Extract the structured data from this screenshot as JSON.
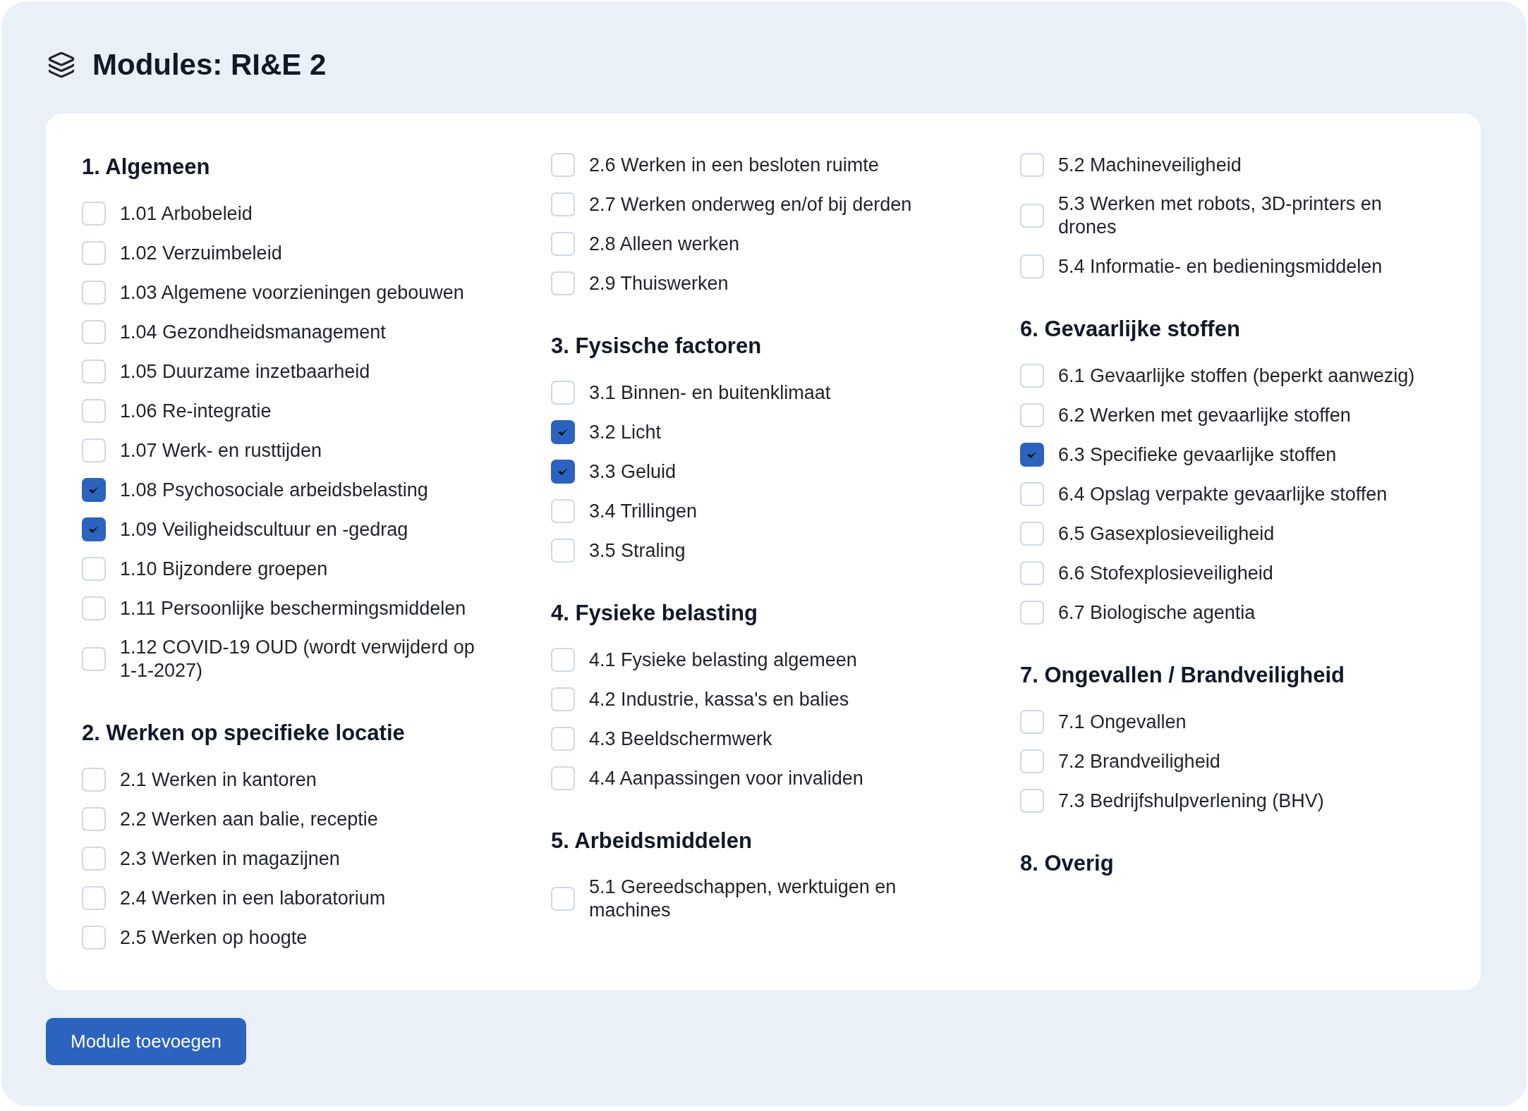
{
  "title": "Modules: RI&E 2",
  "columns": [
    {
      "sections": [
        {
          "heading": "1. Algemeen",
          "modules": [
            {
              "label": "1.01 Arbobeleid",
              "checked": false
            },
            {
              "label": "1.02 Verzuimbeleid",
              "checked": false
            },
            {
              "label": "1.03 Algemene voorzieningen gebouwen",
              "checked": false
            },
            {
              "label": "1.04 Gezondheidsmanagement",
              "checked": false
            },
            {
              "label": "1.05 Duurzame inzetbaarheid",
              "checked": false
            },
            {
              "label": "1.06 Re-integratie",
              "checked": false
            },
            {
              "label": "1.07 Werk- en rusttijden",
              "checked": false
            },
            {
              "label": "1.08 Psychosociale arbeidsbelasting",
              "checked": true
            },
            {
              "label": "1.09 Veiligheidscultuur en -gedrag",
              "checked": true
            },
            {
              "label": "1.10 Bijzondere groepen",
              "checked": false
            },
            {
              "label": "1.11 Persoonlijke beschermingsmiddelen",
              "checked": false
            },
            {
              "label": "1.12 COVID-19 OUD (wordt verwijderd op 1-1-2027)",
              "checked": false
            }
          ]
        },
        {
          "heading": "2. Werken op specifieke locatie",
          "modules": [
            {
              "label": "2.1 Werken in kantoren",
              "checked": false
            },
            {
              "label": "2.2 Werken aan balie, receptie",
              "checked": false
            },
            {
              "label": "2.3 Werken in magazijnen",
              "checked": false
            },
            {
              "label": "2.4 Werken in een laboratorium",
              "checked": false
            },
            {
              "label": "2.5 Werken op hoogte",
              "checked": false
            }
          ]
        }
      ]
    },
    {
      "sections": [
        {
          "modules": [
            {
              "label": "2.6 Werken in een besloten ruimte",
              "checked": false
            },
            {
              "label": "2.7 Werken onderweg en/of bij derden",
              "checked": false
            },
            {
              "label": "2.8 Alleen werken",
              "checked": false
            },
            {
              "label": "2.9 Thuiswerken",
              "checked": false
            }
          ]
        },
        {
          "heading": "3. Fysische factoren",
          "modules": [
            {
              "label": "3.1 Binnen- en buitenklimaat",
              "checked": false
            },
            {
              "label": "3.2 Licht",
              "checked": true
            },
            {
              "label": "3.3 Geluid",
              "checked": true
            },
            {
              "label": "3.4 Trillingen",
              "checked": false
            },
            {
              "label": "3.5 Straling",
              "checked": false
            }
          ]
        },
        {
          "heading": "4. Fysieke belasting",
          "modules": [
            {
              "label": "4.1 Fysieke belasting algemeen",
              "checked": false
            },
            {
              "label": "4.2 Industrie, kassa's en balies",
              "checked": false
            },
            {
              "label": "4.3 Beeldschermwerk",
              "checked": false
            },
            {
              "label": "4.4 Aanpassingen voor invaliden",
              "checked": false
            }
          ]
        },
        {
          "heading": "5. Arbeidsmiddelen",
          "modules": [
            {
              "label": "5.1 Gereedschappen, werktuigen en machines",
              "checked": false
            }
          ]
        }
      ]
    },
    {
      "sections": [
        {
          "modules": [
            {
              "label": "5.2 Machineveiligheid",
              "checked": false
            },
            {
              "label": "5.3 Werken met robots, 3D-printers en drones",
              "checked": false
            },
            {
              "label": "5.4 Informatie- en bedieningsmiddelen",
              "checked": false
            }
          ]
        },
        {
          "heading": "6. Gevaarlijke stoffen",
          "modules": [
            {
              "label": "6.1 Gevaarlijke stoffen (beperkt aanwezig)",
              "checked": false
            },
            {
              "label": "6.2 Werken met gevaarlijke stoffen",
              "checked": false
            },
            {
              "label": "6.3 Specifieke gevaarlijke stoffen",
              "checked": true
            },
            {
              "label": "6.4 Opslag verpakte gevaarlijke stoffen",
              "checked": false
            },
            {
              "label": "6.5 Gasexplosieveiligheid",
              "checked": false
            },
            {
              "label": "6.6 Stofexplosieveiligheid",
              "checked": false
            },
            {
              "label": "6.7 Biologische agentia",
              "checked": false
            }
          ]
        },
        {
          "heading": "7. Ongevallen / Brandveiligheid",
          "modules": [
            {
              "label": "7.1 Ongevallen",
              "checked": false
            },
            {
              "label": "7.2 Brandveiligheid",
              "checked": false
            },
            {
              "label": "7.3 Bedrijfshulpverlening (BHV)",
              "checked": false
            }
          ]
        },
        {
          "heading": "8. Overig"
        }
      ]
    }
  ],
  "add_button": {
    "label": "Module toevoegen"
  }
}
